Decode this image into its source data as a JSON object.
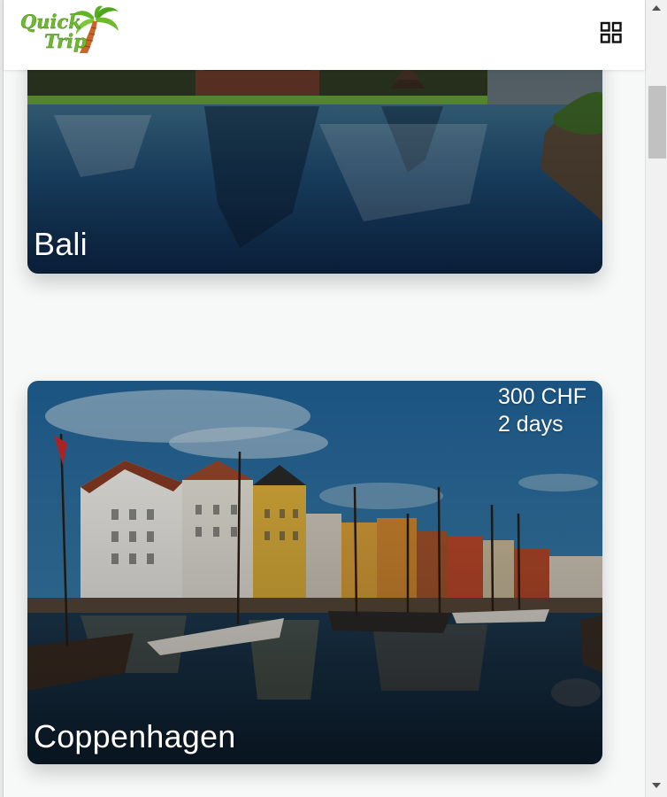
{
  "app": {
    "logo_text_line1": "Quick",
    "logo_text_line2": "Trip",
    "menu_icon": "grid-icon"
  },
  "destinations": [
    {
      "name": "Bali",
      "price": "",
      "duration": ""
    },
    {
      "name": "Coppenhagen",
      "price": "300 CHF",
      "duration": "2 days"
    }
  ],
  "colors": {
    "logo_green": "#6dbb2c",
    "logo_trunk": "#c8652a",
    "header_bg": "#ffffff",
    "page_bg": "#f7f9f9"
  }
}
